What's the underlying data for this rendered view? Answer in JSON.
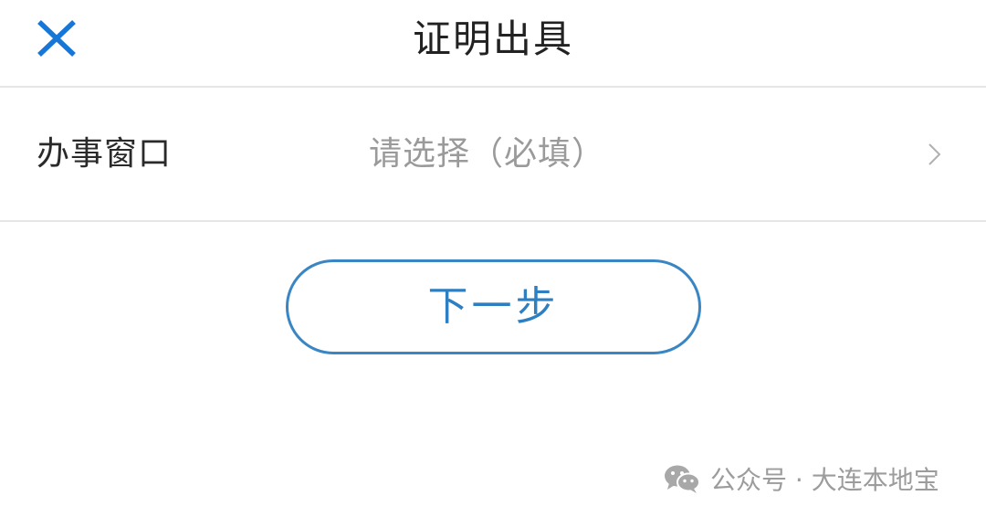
{
  "header": {
    "title": "证明出具",
    "close_icon": "close-icon"
  },
  "form": {
    "label": "办事窗口",
    "placeholder": "请选择（必填）",
    "chevron_icon": "chevron-right-icon"
  },
  "actions": {
    "next_label": "下一步"
  },
  "watermark": {
    "text": "公众号 · 大连本地宝",
    "icon": "wechat-icon"
  },
  "colors": {
    "accent": "#2d7fc2",
    "close_icon": "#1677d8",
    "divider": "#e6e6e6",
    "placeholder": "#9a9a9a",
    "text": "#222222"
  }
}
